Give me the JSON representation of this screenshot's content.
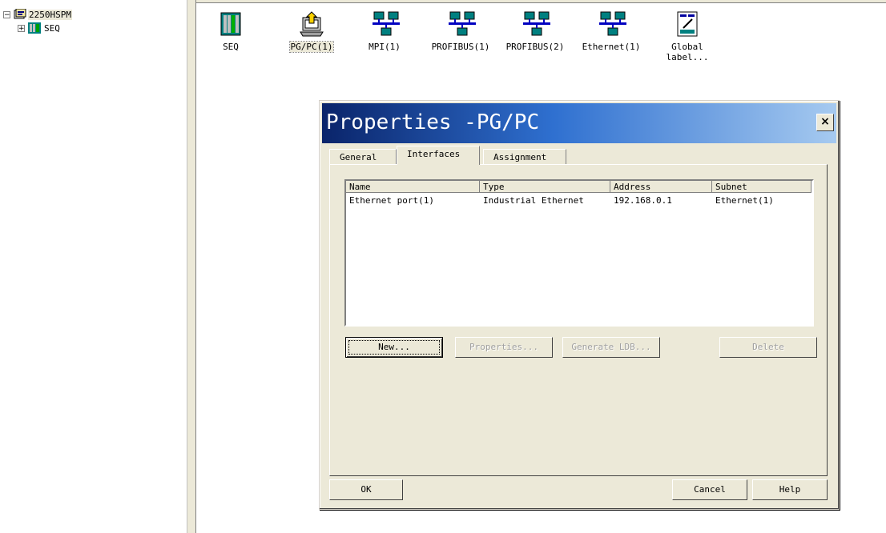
{
  "tree": {
    "root": {
      "expander": "−",
      "label": "2250HSPM"
    },
    "children": [
      {
        "expander": "+",
        "label": "SEQ"
      }
    ]
  },
  "objects": [
    {
      "label": "SEQ",
      "icon": "station-icon"
    },
    {
      "label": "PG/PC(1)",
      "icon": "pgpc-icon"
    },
    {
      "label": "MPI(1)",
      "icon": "network-icon"
    },
    {
      "label": "PROFIBUS(1)",
      "icon": "network-icon"
    },
    {
      "label": "PROFIBUS(2)",
      "icon": "network-icon"
    },
    {
      "label": "Ethernet(1)",
      "icon": "network-icon"
    },
    {
      "label_line1": "Global",
      "label_line2": "label...",
      "icon": "global-label-icon"
    }
  ],
  "dialog": {
    "title": "Properties -PG/PC",
    "close_label": "×",
    "tabs": [
      {
        "label": "General"
      },
      {
        "label": "Interfaces"
      },
      {
        "label": "Assignment"
      }
    ],
    "active_tab": "Interfaces",
    "table": {
      "columns": [
        "Name",
        "Type",
        "Address",
        "Subnet"
      ],
      "rows": [
        [
          "Ethernet port(1)",
          "Industrial Ethernet",
          "192.168.0.1",
          "Ethernet(1)"
        ]
      ]
    },
    "buttons": {
      "new": "New...",
      "properties": "Properties...",
      "generate_ldb": "Generate LDB...",
      "delete": "Delete",
      "ok": "OK",
      "cancel": "Cancel",
      "help": "Help"
    }
  },
  "colors": {
    "window_bg": "#ece9d8",
    "title_gradient_start": "#0a246a",
    "title_gradient_end": "#a6caf0"
  }
}
